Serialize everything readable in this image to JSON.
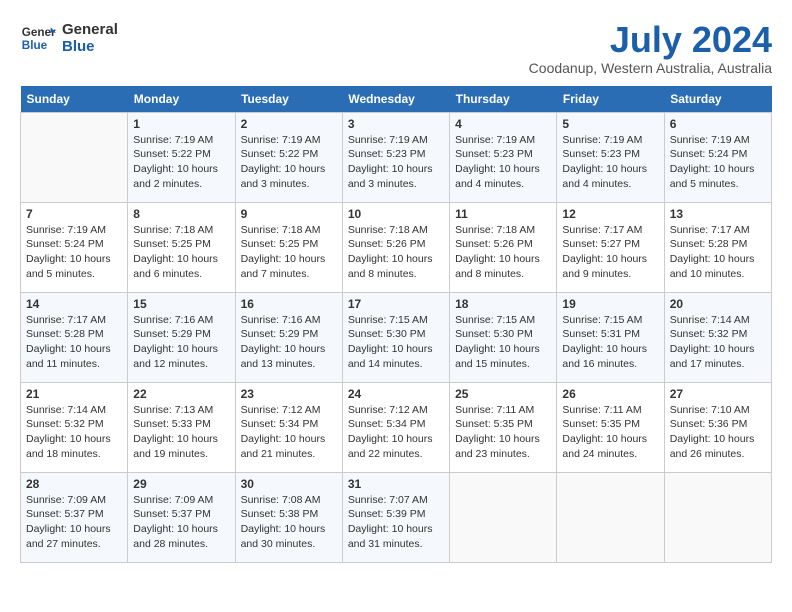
{
  "header": {
    "logo_line1": "General",
    "logo_line2": "Blue",
    "month": "July 2024",
    "location": "Coodanup, Western Australia, Australia"
  },
  "weekdays": [
    "Sunday",
    "Monday",
    "Tuesday",
    "Wednesday",
    "Thursday",
    "Friday",
    "Saturday"
  ],
  "weeks": [
    [
      {
        "day": "",
        "info": ""
      },
      {
        "day": "1",
        "info": "Sunrise: 7:19 AM\nSunset: 5:22 PM\nDaylight: 10 hours\nand 2 minutes."
      },
      {
        "day": "2",
        "info": "Sunrise: 7:19 AM\nSunset: 5:22 PM\nDaylight: 10 hours\nand 3 minutes."
      },
      {
        "day": "3",
        "info": "Sunrise: 7:19 AM\nSunset: 5:23 PM\nDaylight: 10 hours\nand 3 minutes."
      },
      {
        "day": "4",
        "info": "Sunrise: 7:19 AM\nSunset: 5:23 PM\nDaylight: 10 hours\nand 4 minutes."
      },
      {
        "day": "5",
        "info": "Sunrise: 7:19 AM\nSunset: 5:23 PM\nDaylight: 10 hours\nand 4 minutes."
      },
      {
        "day": "6",
        "info": "Sunrise: 7:19 AM\nSunset: 5:24 PM\nDaylight: 10 hours\nand 5 minutes."
      }
    ],
    [
      {
        "day": "7",
        "info": "Sunrise: 7:19 AM\nSunset: 5:24 PM\nDaylight: 10 hours\nand 5 minutes."
      },
      {
        "day": "8",
        "info": "Sunrise: 7:18 AM\nSunset: 5:25 PM\nDaylight: 10 hours\nand 6 minutes."
      },
      {
        "day": "9",
        "info": "Sunrise: 7:18 AM\nSunset: 5:25 PM\nDaylight: 10 hours\nand 7 minutes."
      },
      {
        "day": "10",
        "info": "Sunrise: 7:18 AM\nSunset: 5:26 PM\nDaylight: 10 hours\nand 8 minutes."
      },
      {
        "day": "11",
        "info": "Sunrise: 7:18 AM\nSunset: 5:26 PM\nDaylight: 10 hours\nand 8 minutes."
      },
      {
        "day": "12",
        "info": "Sunrise: 7:17 AM\nSunset: 5:27 PM\nDaylight: 10 hours\nand 9 minutes."
      },
      {
        "day": "13",
        "info": "Sunrise: 7:17 AM\nSunset: 5:28 PM\nDaylight: 10 hours\nand 10 minutes."
      }
    ],
    [
      {
        "day": "14",
        "info": "Sunrise: 7:17 AM\nSunset: 5:28 PM\nDaylight: 10 hours\nand 11 minutes."
      },
      {
        "day": "15",
        "info": "Sunrise: 7:16 AM\nSunset: 5:29 PM\nDaylight: 10 hours\nand 12 minutes."
      },
      {
        "day": "16",
        "info": "Sunrise: 7:16 AM\nSunset: 5:29 PM\nDaylight: 10 hours\nand 13 minutes."
      },
      {
        "day": "17",
        "info": "Sunrise: 7:15 AM\nSunset: 5:30 PM\nDaylight: 10 hours\nand 14 minutes."
      },
      {
        "day": "18",
        "info": "Sunrise: 7:15 AM\nSunset: 5:30 PM\nDaylight: 10 hours\nand 15 minutes."
      },
      {
        "day": "19",
        "info": "Sunrise: 7:15 AM\nSunset: 5:31 PM\nDaylight: 10 hours\nand 16 minutes."
      },
      {
        "day": "20",
        "info": "Sunrise: 7:14 AM\nSunset: 5:32 PM\nDaylight: 10 hours\nand 17 minutes."
      }
    ],
    [
      {
        "day": "21",
        "info": "Sunrise: 7:14 AM\nSunset: 5:32 PM\nDaylight: 10 hours\nand 18 minutes."
      },
      {
        "day": "22",
        "info": "Sunrise: 7:13 AM\nSunset: 5:33 PM\nDaylight: 10 hours\nand 19 minutes."
      },
      {
        "day": "23",
        "info": "Sunrise: 7:12 AM\nSunset: 5:34 PM\nDaylight: 10 hours\nand 21 minutes."
      },
      {
        "day": "24",
        "info": "Sunrise: 7:12 AM\nSunset: 5:34 PM\nDaylight: 10 hours\nand 22 minutes."
      },
      {
        "day": "25",
        "info": "Sunrise: 7:11 AM\nSunset: 5:35 PM\nDaylight: 10 hours\nand 23 minutes."
      },
      {
        "day": "26",
        "info": "Sunrise: 7:11 AM\nSunset: 5:35 PM\nDaylight: 10 hours\nand 24 minutes."
      },
      {
        "day": "27",
        "info": "Sunrise: 7:10 AM\nSunset: 5:36 PM\nDaylight: 10 hours\nand 26 minutes."
      }
    ],
    [
      {
        "day": "28",
        "info": "Sunrise: 7:09 AM\nSunset: 5:37 PM\nDaylight: 10 hours\nand 27 minutes."
      },
      {
        "day": "29",
        "info": "Sunrise: 7:09 AM\nSunset: 5:37 PM\nDaylight: 10 hours\nand 28 minutes."
      },
      {
        "day": "30",
        "info": "Sunrise: 7:08 AM\nSunset: 5:38 PM\nDaylight: 10 hours\nand 30 minutes."
      },
      {
        "day": "31",
        "info": "Sunrise: 7:07 AM\nSunset: 5:39 PM\nDaylight: 10 hours\nand 31 minutes."
      },
      {
        "day": "",
        "info": ""
      },
      {
        "day": "",
        "info": ""
      },
      {
        "day": "",
        "info": ""
      }
    ]
  ]
}
